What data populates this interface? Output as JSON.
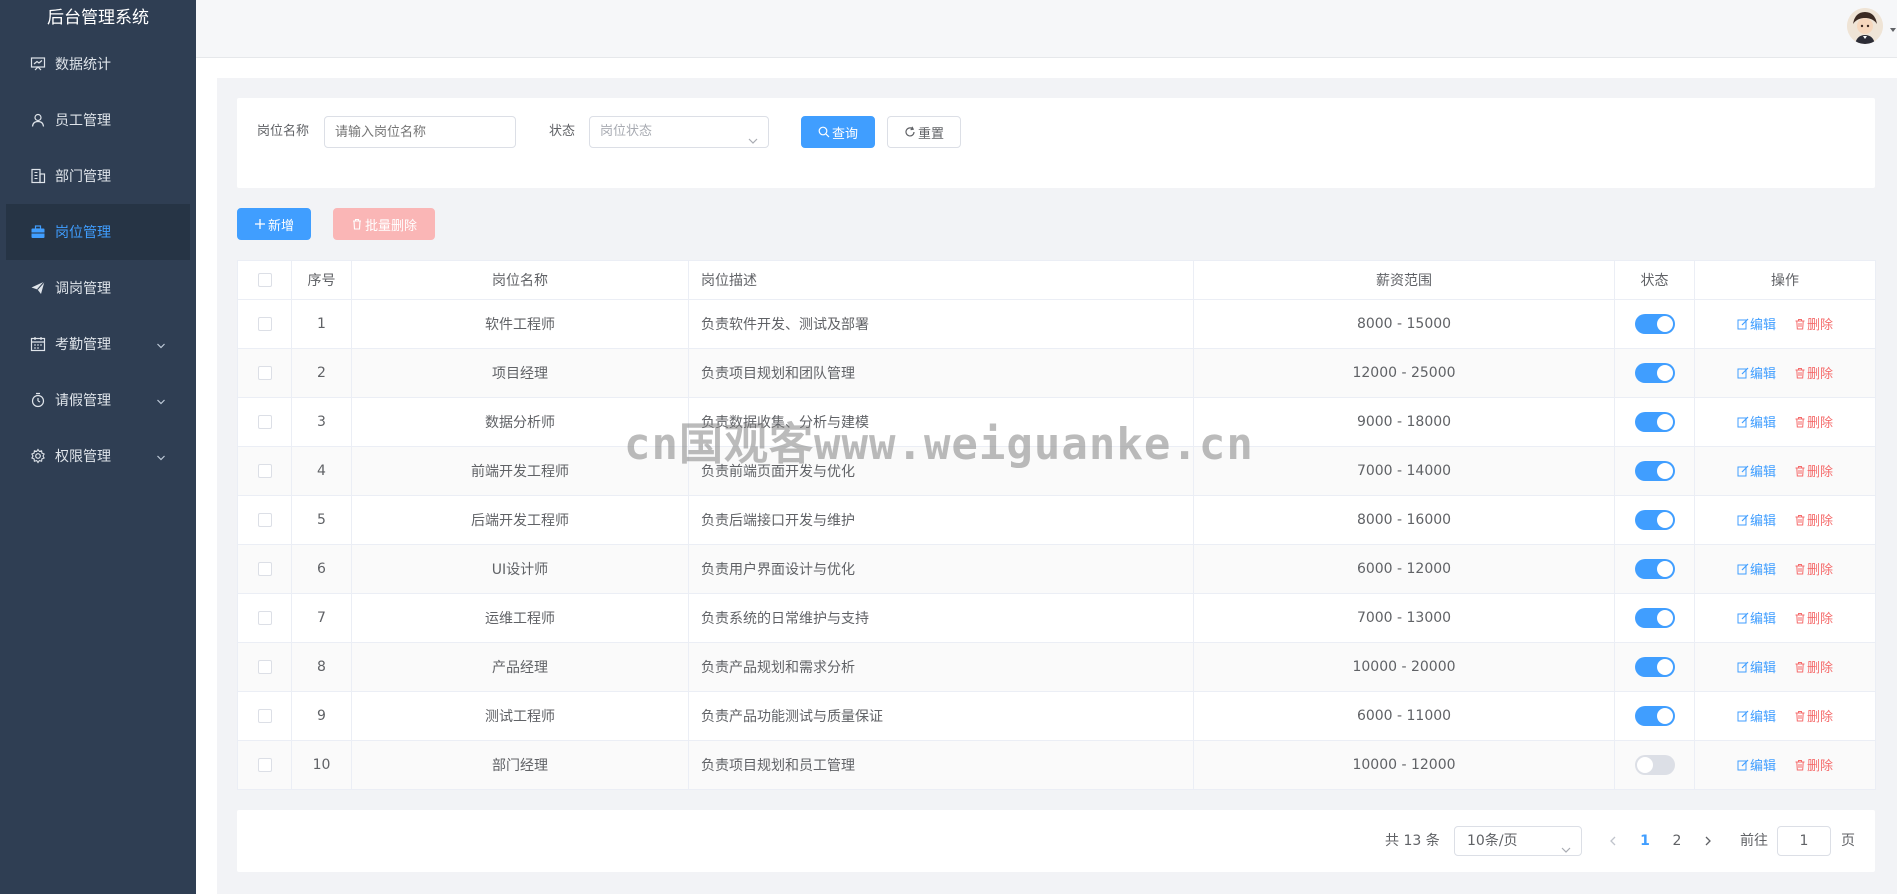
{
  "app": {
    "title": "后台管理系统"
  },
  "sidebar": {
    "items": [
      {
        "label": "数据统计",
        "icon": "chart-board-icon",
        "active": false,
        "expandable": false
      },
      {
        "label": "员工管理",
        "icon": "user-icon",
        "active": false,
        "expandable": false
      },
      {
        "label": "部门管理",
        "icon": "office-building-icon",
        "active": false,
        "expandable": false
      },
      {
        "label": "岗位管理",
        "icon": "briefcase-icon",
        "active": true,
        "expandable": false
      },
      {
        "label": "调岗管理",
        "icon": "paper-plane-icon",
        "active": false,
        "expandable": false
      },
      {
        "label": "考勤管理",
        "icon": "calendar-icon",
        "active": false,
        "expandable": true
      },
      {
        "label": "请假管理",
        "icon": "stopwatch-icon",
        "active": false,
        "expandable": true
      },
      {
        "label": "权限管理",
        "icon": "gear-icon",
        "active": false,
        "expandable": true
      }
    ]
  },
  "search": {
    "name_label": "岗位名称",
    "name_placeholder": "请输入岗位名称",
    "name_value": "",
    "status_label": "状态",
    "status_placeholder": "岗位状态",
    "query_label": "查询",
    "reset_label": "重置"
  },
  "toolbar": {
    "add_label": "新增",
    "batch_delete_label": "批量删除"
  },
  "table": {
    "columns": [
      "序号",
      "岗位名称",
      "岗位描述",
      "薪资范围",
      "状态",
      "操作"
    ],
    "edit_label": "编辑",
    "delete_label": "删除",
    "rows": [
      {
        "index": "1",
        "name": "软件工程师",
        "desc": "负责软件开发、测试及部署",
        "salary": "8000 - 15000",
        "enabled": true
      },
      {
        "index": "2",
        "name": "项目经理",
        "desc": "负责项目规划和团队管理",
        "salary": "12000 - 25000",
        "enabled": true
      },
      {
        "index": "3",
        "name": "数据分析师",
        "desc": "负责数据收集、分析与建模",
        "salary": "9000 - 18000",
        "enabled": true
      },
      {
        "index": "4",
        "name": "前端开发工程师",
        "desc": "负责前端页面开发与优化",
        "salary": "7000 - 14000",
        "enabled": true
      },
      {
        "index": "5",
        "name": "后端开发工程师",
        "desc": "负责后端接口开发与维护",
        "salary": "8000 - 16000",
        "enabled": true
      },
      {
        "index": "6",
        "name": "UI设计师",
        "desc": "负责用户界面设计与优化",
        "salary": "6000 - 12000",
        "enabled": true
      },
      {
        "index": "7",
        "name": "运维工程师",
        "desc": "负责系统的日常维护与支持",
        "salary": "7000 - 13000",
        "enabled": true
      },
      {
        "index": "8",
        "name": "产品经理",
        "desc": "负责产品规划和需求分析",
        "salary": "10000 - 20000",
        "enabled": true
      },
      {
        "index": "9",
        "name": "测试工程师",
        "desc": "负责产品功能测试与质量保证",
        "salary": "6000 - 11000",
        "enabled": true
      },
      {
        "index": "10",
        "name": "部门经理",
        "desc": "负责项目规划和员工管理",
        "salary": "10000 - 12000",
        "enabled": false
      }
    ]
  },
  "pagination": {
    "total_text": "共 13 条",
    "page_size": "10条/页",
    "pages": [
      "1",
      "2"
    ],
    "current_page": "1",
    "goto_label": "前往",
    "goto_value": "1",
    "page_suffix": "页"
  },
  "watermark": "cn国观客www.weiguanke.cn",
  "colors": {
    "sidebar_bg": "#2f3e53",
    "primary": "#409eff",
    "danger": "#f56c6c",
    "danger_disabled": "#fab6b6",
    "main_bg": "#f2f3f6"
  }
}
